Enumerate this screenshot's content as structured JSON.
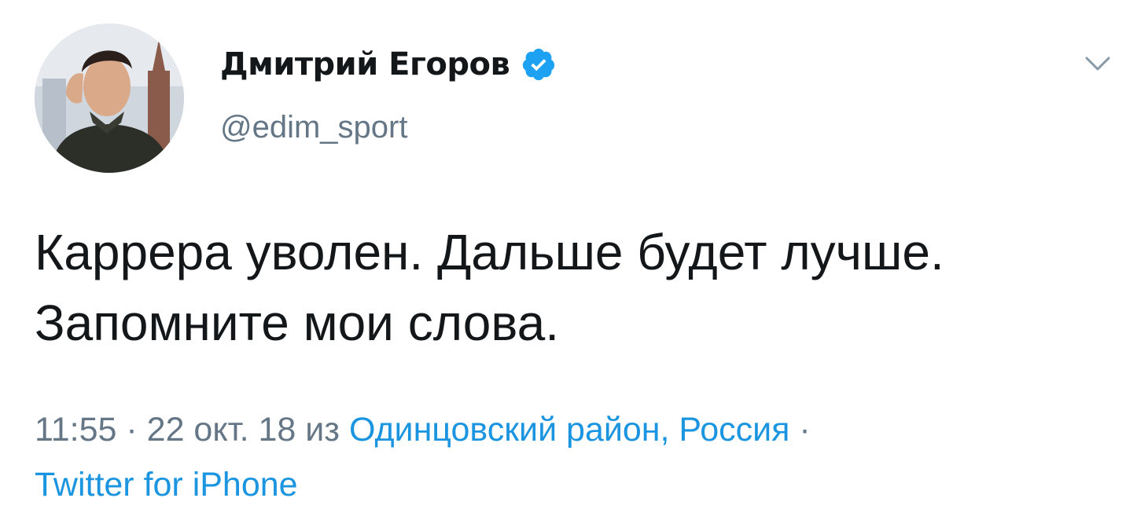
{
  "tweet": {
    "display_name": "Дмитрий Егоров",
    "handle": "@edim_sport",
    "verified_icon": "verified-badge-icon",
    "menu_icon": "chevron-down-icon",
    "text": "Каррера уволен. Дальше будет лучше. Запомните мои слова.",
    "time": "11:55",
    "separator": "·",
    "date": "22 окт. 18",
    "from_word": "из",
    "location": "Одинцовский район, Россия",
    "source": "Twitter for iPhone"
  },
  "colors": {
    "text": "#14171a",
    "secondary": "#657786",
    "link": "#1b95e0",
    "verified": "#1da1f2"
  }
}
